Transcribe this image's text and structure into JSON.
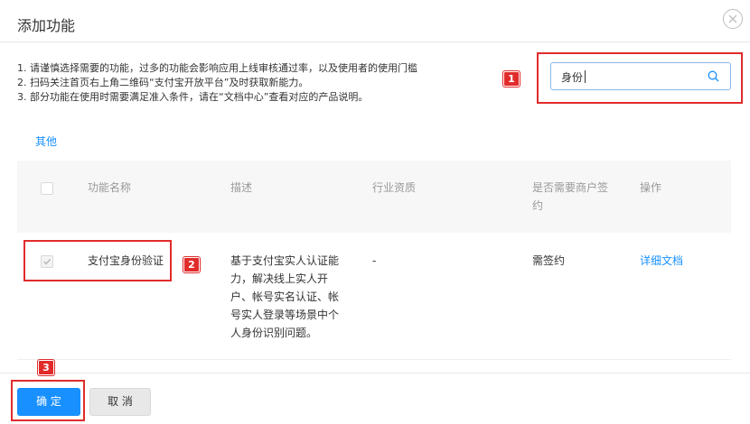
{
  "dialog": {
    "title": "添加功能"
  },
  "notes": [
    "1. 请谨慎选择需要的功能，过多的功能会影响应用上线审核通过率，以及使用者的使用门槛",
    "2. 扫码关注首页右上角二维码“支付宝开放平台”及时获取新能力。",
    "3. 部分功能在使用时需要满足准入条件，请在“文档中心”查看对应的产品说明。"
  ],
  "search": {
    "value": "身份"
  },
  "annotations": {
    "badge1": "1",
    "badge2": "2",
    "badge3": "3",
    "color": "#e12b2b"
  },
  "category_tab": "其他",
  "table": {
    "headers": {
      "name": "功能名称",
      "desc": "描述",
      "qualification": "行业资质",
      "sign_line1": "是否需要商户签",
      "sign_line2": "约",
      "action": "操作"
    },
    "rows": [
      {
        "checked": true,
        "name": "支付宝身份验证",
        "desc_lines": [
          "基于支付宝实人认证能",
          "力，解决线上实人开",
          "户、帐号实名认证、帐",
          "号实人登录等场景中个",
          "人身份识别问题。"
        ],
        "qualification": "-",
        "sign": "需签约",
        "action": "详细文档"
      }
    ]
  },
  "footer": {
    "ok": "确 定",
    "cancel": "取 消"
  },
  "colors": {
    "primary": "#1890ff",
    "header_bg": "#f7f7f7"
  }
}
